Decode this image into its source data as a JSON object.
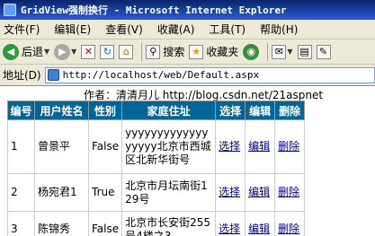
{
  "window": {
    "title": "GridView强制换行 - Microsoft Internet Explorer"
  },
  "menu": [
    "文件(F)",
    "编辑(E)",
    "查看(V)",
    "收藏(A)",
    "工具(T)",
    "帮助(H)"
  ],
  "toolbar": {
    "back": "后退",
    "search": "搜索",
    "favorites": "收藏夹"
  },
  "address": {
    "label": "地址(D)",
    "url": "http://localhost/web/Default.aspx"
  },
  "page": {
    "author": "作者：清清月儿 http://blog.csdn.net/21aspnet"
  },
  "grid": {
    "headers": [
      "编号",
      "用户姓名",
      "性别",
      "家庭住址",
      "选择",
      "编辑",
      "删除"
    ],
    "rows": [
      [
        "1",
        "曾景平",
        "False",
        "yyyyyyyyyyyyyyyyyy北京市西城区北新华街号",
        "选择",
        "编辑",
        "删除"
      ],
      [
        "2",
        "杨宛君1",
        "True",
        "北京市月坛南街129号",
        "选择",
        "编辑",
        "删除"
      ],
      [
        "3",
        "陈锦秀",
        "False",
        "北京市长安街255号4楼之3",
        "选择",
        "编辑",
        "删除"
      ]
    ]
  }
}
